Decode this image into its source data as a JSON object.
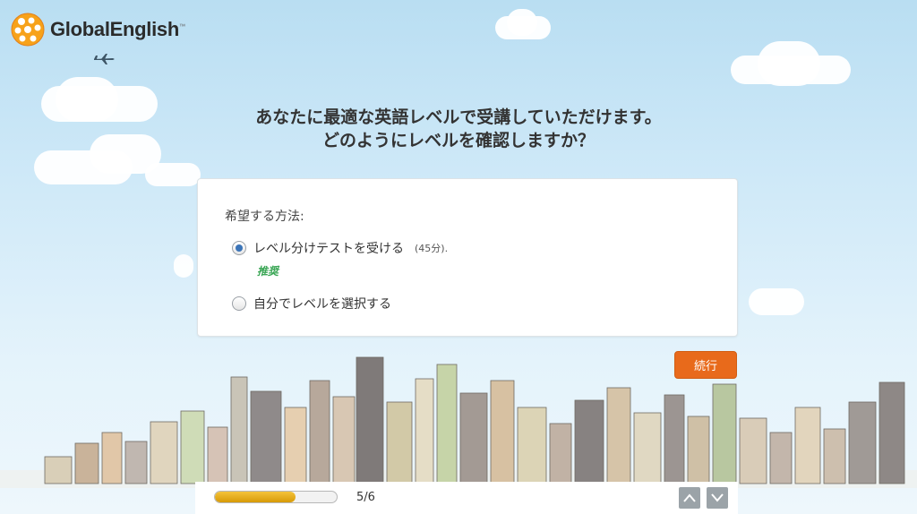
{
  "brand": {
    "name": "GlobalEnglish",
    "tm": "™"
  },
  "question": {
    "line1": "あなたに最適な英語レベルで受講していただけます。",
    "line2": "どのようにレベルを確認しますか？"
  },
  "form": {
    "label": "希望する方法:",
    "options": [
      {
        "label": "レベル分けテストを受ける",
        "note": "(45分).",
        "badge": "推奨",
        "selected": true
      },
      {
        "label": "自分でレベルを選択する",
        "selected": false
      }
    ]
  },
  "continue_label": "続行",
  "footer": {
    "progress": 0.66,
    "page_indicator": "5/6"
  },
  "icons": [
    "globalenglish-logo-icon",
    "airplane-icon",
    "chevron-up-icon",
    "chevron-down-icon"
  ],
  "colors": {
    "accent": "#e86a1b",
    "radio_selected": "#3b74b8",
    "recommended": "#3aa655",
    "progress": "#e6aa17"
  }
}
